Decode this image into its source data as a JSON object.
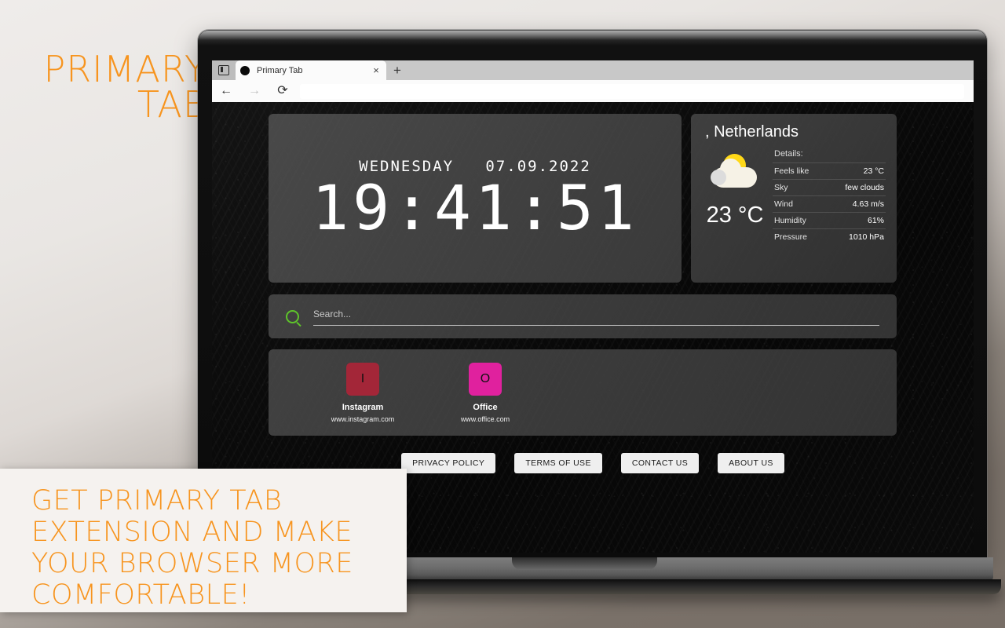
{
  "promo": {
    "headline_line1": "PRIMARY",
    "headline_line2": "TAB",
    "cta": "GET PRIMARY TAB EXTENSION AND MAKE YOUR BROWSER MORE COMFORTABLE!"
  },
  "browser": {
    "tab": {
      "title": "Primary Tab",
      "close_label": "×",
      "favicon": "black-circle-icon"
    },
    "new_tab_label": "+",
    "tab_list_icon": "tab-list-icon",
    "nav": {
      "back": "←",
      "forward": "→",
      "reload": "⟳"
    },
    "url_value": ""
  },
  "clock": {
    "weekday": "WEDNESDAY",
    "date": "07.09.2022",
    "date_line": "WEDNESDAY   07.09.2022",
    "time": "19:41:51"
  },
  "weather": {
    "location": ", Netherlands",
    "icon": "sun-behind-cloud-icon",
    "temperature": "23 °C",
    "details_label": "Details:",
    "rows": [
      {
        "key": "Feels like",
        "value": "23 °C"
      },
      {
        "key": "Sky",
        "value": "few clouds"
      },
      {
        "key": "Wind",
        "value": "4.63 m/s"
      },
      {
        "key": "Humidity",
        "value": "61%"
      },
      {
        "key": "Pressure",
        "value": "1010 hPa"
      }
    ]
  },
  "search": {
    "placeholder": "Search...",
    "icon": "search-icon",
    "icon_color": "#5ec42a"
  },
  "bookmarks": [
    {
      "letter": "I",
      "name": "Instagram",
      "url": "www.instagram.com",
      "color": "#a32638"
    },
    {
      "letter": "O",
      "name": "Office",
      "url": "www.office.com",
      "color": "#e0219e"
    }
  ],
  "footer_buttons": [
    {
      "label": "PRIVACY POLICY"
    },
    {
      "label": "TERMS OF USE"
    },
    {
      "label": "CONTACT US"
    },
    {
      "label": "ABOUT US"
    }
  ],
  "colors": {
    "accent_orange": "#f7941e",
    "search_green": "#5ec42a",
    "sun_yellow": "#ffd817"
  }
}
